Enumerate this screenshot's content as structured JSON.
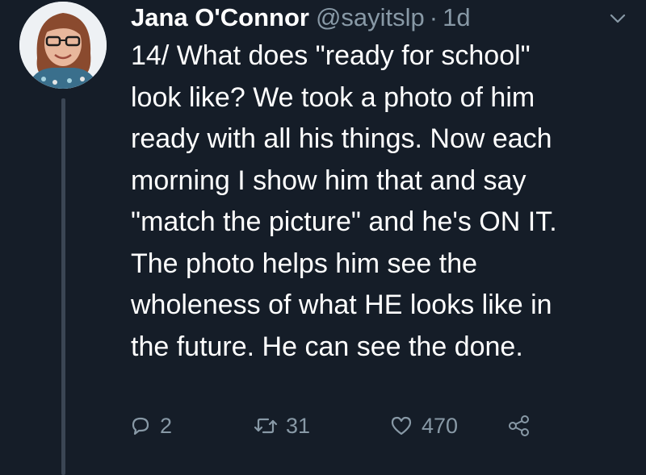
{
  "tweet": {
    "author_name": "Jana O'Connor",
    "handle": "@sayitslp",
    "separator": "·",
    "time": "1d",
    "text_lines": [
      "14/ What does \"ready for school\"",
      "look like? We took a photo of him",
      "ready with all his things. Now each",
      "morning I show him that and say",
      "\"match the picture\" and he's ON IT.",
      "The photo helps him see the",
      "wholeness of what HE looks like in",
      "the future. He can see the done."
    ],
    "actions": {
      "reply_count": "2",
      "retweet_count": "31",
      "like_count": "470"
    },
    "icons": {
      "reply": "reply-icon",
      "retweet": "retweet-icon",
      "like": "heart-icon",
      "share": "share-icon",
      "menu": "chevron-down-icon"
    }
  },
  "colors": {
    "background": "#151d28",
    "muted": "#8899a6",
    "text": "#ffffff"
  }
}
